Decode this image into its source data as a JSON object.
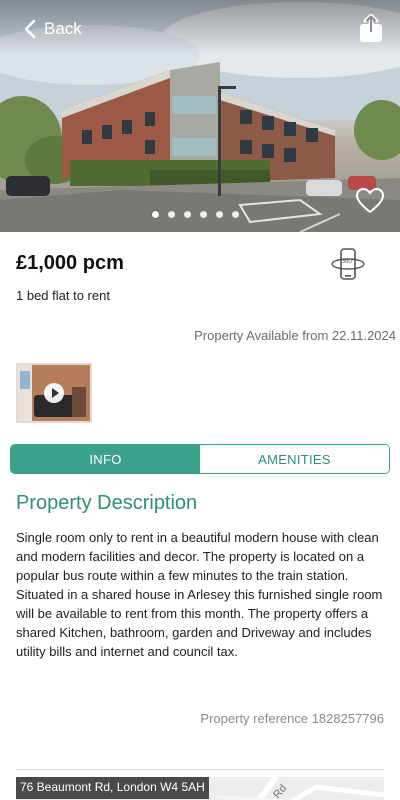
{
  "header": {
    "back_label": "Back",
    "back_icon": "chevron-left-icon",
    "share_icon": "share-icon"
  },
  "gallery": {
    "image_count": 6,
    "active_index": 0,
    "favorite_icon": "heart-outline-icon"
  },
  "listing": {
    "price": "£1,000 pcm",
    "type": "1 bed flat to rent",
    "vr_icon": "360-view-icon",
    "availability": "Property Available from 22.11.2024"
  },
  "media": {
    "video_icon": "play-icon"
  },
  "tabs": [
    {
      "label": "INFO",
      "active": true
    },
    {
      "label": "AMENITIES",
      "active": false
    }
  ],
  "description": {
    "title": "Property Description",
    "body": "Single room only to rent in a beautiful modern house with clean and modern facilities and decor. The property is located on a popular bus route within a few minutes to the train station. Situated in a shared house in Arlesey this furnished single room will be available to rent from this month. The property offers a shared Kitchen, bathroom, garden and Driveway and includes utility bills and internet and council tax."
  },
  "reference": "Property reference 1828257796",
  "map": {
    "address": "76 Beaumont Rd, London W4 5AH"
  },
  "colors": {
    "accent": "#3aa28a",
    "accent_text": "#2e8f77"
  }
}
